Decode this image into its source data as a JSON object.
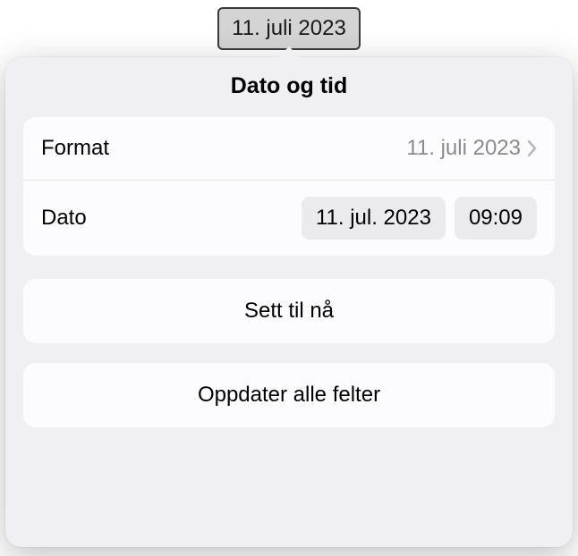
{
  "field": {
    "value": "11. juli 2023"
  },
  "popover": {
    "title": "Dato og tid",
    "format_row": {
      "label": "Format",
      "value": "11. juli 2023"
    },
    "date_row": {
      "label": "Dato",
      "date_value": "11. jul. 2023",
      "time_value": "09:09"
    },
    "actions": {
      "set_now": "Sett til nå",
      "update_all": "Oppdater alle felter"
    }
  }
}
